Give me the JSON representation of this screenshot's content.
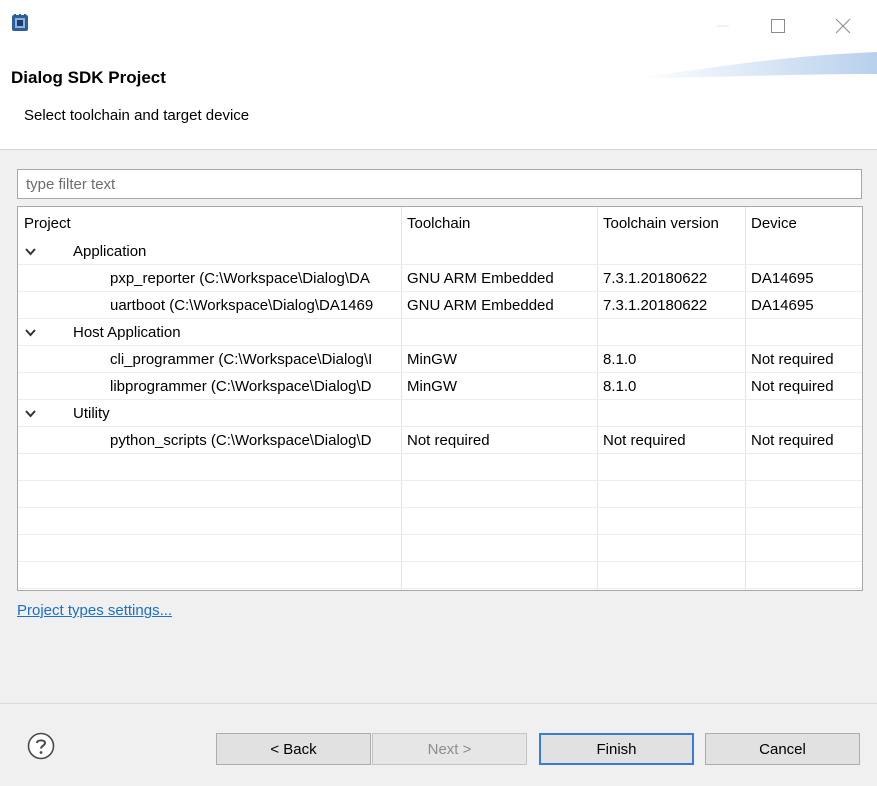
{
  "window": {
    "icon": "dialog-app-icon"
  },
  "header": {
    "title": "Dialog SDK Project",
    "subtitle": "Select toolchain and target device"
  },
  "filter": {
    "placeholder": "type filter text",
    "value": ""
  },
  "table": {
    "columns": [
      "Project",
      "Toolchain",
      "Toolchain version",
      "Device"
    ],
    "rows": [
      {
        "type": "group",
        "label": "Application",
        "expanded": true
      },
      {
        "type": "item",
        "project": "pxp_reporter (C:\\Workspace\\Dialog\\DA",
        "toolchain": "GNU ARM Embedded",
        "version": "7.3.1.20180622",
        "device": "DA14695"
      },
      {
        "type": "item",
        "project": "uartboot (C:\\Workspace\\Dialog\\DA1469",
        "toolchain": "GNU ARM Embedded",
        "version": "7.3.1.20180622",
        "device": "DA14695"
      },
      {
        "type": "group",
        "label": "Host Application",
        "expanded": true
      },
      {
        "type": "item",
        "project": "cli_programmer (C:\\Workspace\\Dialog\\I",
        "toolchain": "MinGW",
        "version": "8.1.0",
        "device": "Not required"
      },
      {
        "type": "item",
        "project": "libprogrammer (C:\\Workspace\\Dialog\\D",
        "toolchain": "MinGW",
        "version": "8.1.0",
        "device": "Not required"
      },
      {
        "type": "group",
        "label": "Utility",
        "expanded": true
      },
      {
        "type": "item",
        "project": "python_scripts (C:\\Workspace\\Dialog\\D",
        "toolchain": "Not required",
        "version": "Not required",
        "device": "Not required"
      }
    ]
  },
  "link": {
    "label": "Project types settings..."
  },
  "buttons": {
    "back": "< Back",
    "next": "Next >",
    "finish": "Finish",
    "cancel": "Cancel"
  },
  "colors": {
    "link": "#1a6fc8",
    "default_button_border": "#3a7bd5",
    "app_icon": "#2d5f9a"
  }
}
